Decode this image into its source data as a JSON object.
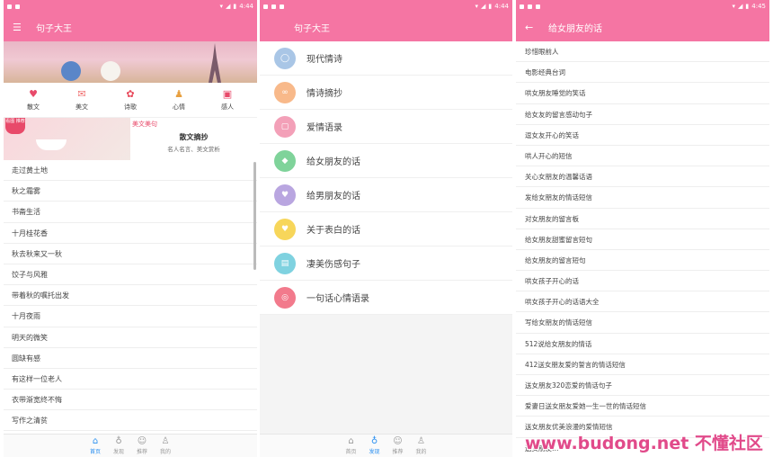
{
  "colors": {
    "accent": "#f575a3",
    "nav_active": "#2a8ff0",
    "badge": "#e84a6a"
  },
  "screen1": {
    "status": {
      "time": "4:44"
    },
    "app_title": "句子大王",
    "categories": [
      {
        "label": "散文",
        "icon": "heart-icon"
      },
      {
        "label": "美文",
        "icon": "envelope-icon"
      },
      {
        "label": "诗歌",
        "icon": "flower-icon"
      },
      {
        "label": "心情",
        "icon": "person-icon"
      },
      {
        "label": "感人",
        "icon": "gift-icon"
      }
    ],
    "promo": {
      "badge": "看图 推荐",
      "tag": "美文美句",
      "title": "散文摘抄",
      "subtitle": "名人名言、美文赏析"
    },
    "list": [
      "走过黄土地",
      "秋之霜雾",
      "书斋生活",
      "十月桂花香",
      "秋去秋来又一秋",
      "饺子与风雅",
      "带着秋的嘱托出发",
      "十月夜雨",
      "明天的微笑",
      "圆缺有感",
      "有这样一位老人",
      "衣带渐宽终不悔",
      "写作之清贫"
    ],
    "bottom_nav": [
      "首页",
      "发现",
      "推荐",
      "我的"
    ]
  },
  "screen2": {
    "status": {
      "time": "4:44"
    },
    "app_title": "句子大王",
    "categories": [
      {
        "label": "现代情诗",
        "color": "#a9c6e6",
        "icon": "chat-bubble-icon"
      },
      {
        "label": "情诗摘抄",
        "color": "#f8b98a",
        "icon": "glasses-icon"
      },
      {
        "label": "爱情语录",
        "color": "#f3a0b8",
        "icon": "lock-icon"
      },
      {
        "label": "给女朋友的话",
        "color": "#7fd39a",
        "icon": "tag-icon"
      },
      {
        "label": "给男朋友的话",
        "color": "#b9a6e0",
        "icon": "heart-icon"
      },
      {
        "label": "关于表白的话",
        "color": "#f7d65a",
        "icon": "heart-icon"
      },
      {
        "label": "凄美伤感句子",
        "color": "#7fd2e0",
        "icon": "bottle-icon"
      },
      {
        "label": "一句话心情语录",
        "color": "#f27a8c",
        "icon": "badge-icon"
      }
    ],
    "bottom_nav": [
      "首页",
      "发现",
      "推荐",
      "我的"
    ]
  },
  "screen3": {
    "status": {
      "time": "4:45"
    },
    "title": "给女朋友的话",
    "list": [
      "珍惜眼前人",
      "电影经典台词",
      "哄女朋友睡觉的笑话",
      "给女友的留言感动句子",
      "逗女友开心的笑话",
      "哄人开心的短信",
      "关心女朋友的温馨话语",
      "发给女朋友的情话短信",
      "对女朋友的留言板",
      "给女朋友甜蜜留言短句",
      "给女朋友的留言短句",
      "哄女孩子开心的话",
      "哄女孩子开心的话语大全",
      "写给女朋友的情话短信",
      "512说给女朋友的情话",
      "412送女朋友爱的誓言的情话短信",
      "送女朋友320恋爱的情话句子",
      "爱妻日送女朋友爱她一生一世的情话短信",
      "送女朋友优美浪漫的爱情短信",
      "送女朋友…"
    ],
    "watermark": "www.budong.net 不懂社区"
  }
}
